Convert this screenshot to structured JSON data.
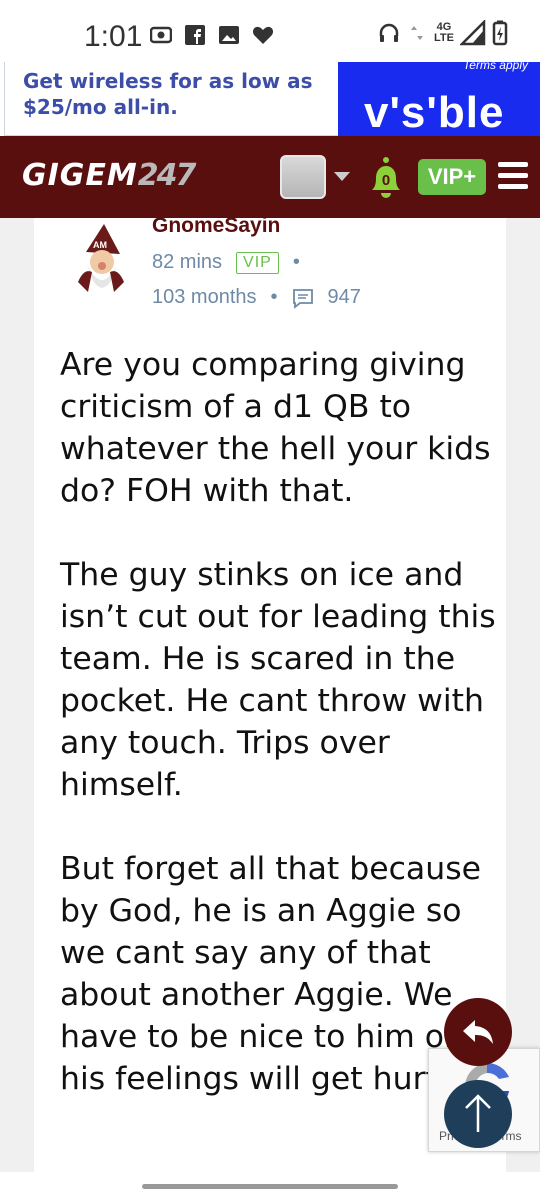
{
  "status_bar": {
    "time": "1:01",
    "network_top": "4G",
    "network_bottom": "LTE",
    "icons": [
      "screen-record-icon",
      "facebook-icon",
      "image-icon",
      "heart-icon",
      "headphones-icon",
      "data-arrows-icon",
      "signal-icon",
      "battery-charging-icon"
    ]
  },
  "ad": {
    "text": "Get wireless for as low as $25/mo all-in.",
    "terms": "Terms apply",
    "brand": "v's'ble",
    "colors": {
      "brand_bg": "#1a2bf0",
      "text": "#3c4ea8"
    }
  },
  "header": {
    "logo_text": "GIGEM",
    "logo_number": "247",
    "notification_count": "0",
    "vip_label": "VIP+",
    "colors": {
      "bg": "#5a0f0f",
      "vip": "#6abf4b",
      "bell": "#8bd13a"
    }
  },
  "post": {
    "author": "GnomeSayin",
    "posted_ago": "82 mins",
    "badge": "VIP",
    "member_for": "103 months",
    "post_count": "947",
    "paragraphs": [
      "Are you comparing giving criticism of a d1 QB to whatever the hell your kids do? FOH with that.",
      "The guy stinks on ice and isn’t cut out for leading this team. He is scared in the pocket. He cant throw with any touch. Trips over himself.",
      "But forget all that because by God, he is an Aggie so we cant say any of that about another Aggie. We have to be nice to him or his feelings will get hurt."
    ]
  },
  "recaptcha": {
    "text": "Privacy - Terms"
  },
  "colors": {
    "maroon": "#5a0f0f",
    "meta": "#6f8aa5",
    "scroll_top": "#1f3e5a"
  }
}
